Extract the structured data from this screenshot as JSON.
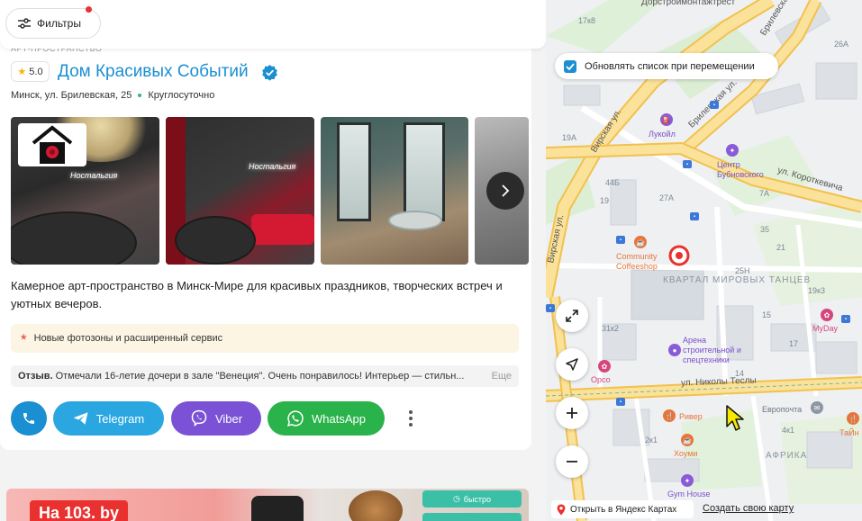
{
  "filters": {
    "label": "Фильтры"
  },
  "card": {
    "category": "АРТ-ПРОСТРАНСТВО",
    "rating": "5.0",
    "title": "Дом Красивых Событий",
    "address": "Минск, ул. Брилевская, 25",
    "hours": "Круглосуточно",
    "description": "Камерное арт-пространство в Минск-Мире для красивых праздников, творческих встреч и уютных вечеров.",
    "promo": "Новые фотозоны и расширенный сервис",
    "review_label": "Отзыв.",
    "review_text": "Отмечали 16-летие дочери в зале \"Венеция\". Очень понравилось! Интерьер — стильн...",
    "review_more": "Еще",
    "buttons": {
      "telegram": "Telegram",
      "viber": "Viber",
      "whatsapp": "WhatsApp"
    }
  },
  "banner": {
    "tag": "На 103. by",
    "pill1": "быстро"
  },
  "map": {
    "update_checkbox_label": "Обновлять список при перемещении",
    "update_checked": true,
    "open_yandex": "Открыть в Яндекс Картах",
    "create_map": "Создать свою карту",
    "streets": {
      "virskaya_top": "Вирская ул.",
      "virskaya_mid": "Вирская ул.",
      "brilevskaya_top": "Брилевская",
      "brilevskaya_mid": "Брилевская ул.",
      "korotkevicha": "ул. Короткевича",
      "tesly": "ул. Николы Теслы",
      "dorstroy": "Дорстроймонтажтрест"
    },
    "houses": [
      "17к8",
      "26А",
      "19А",
      "44Б",
      "27А",
      "7А",
      "25Н",
      "21",
      "19к3",
      "15",
      "31к2",
      "17",
      "2к1",
      "4к1",
      "14",
      "19",
      "35"
    ],
    "pois": {
      "lukoil": "Лукойл",
      "bubnovsky": "Центр Бубновского",
      "community": "Community Coffeeshop",
      "kvartal": "КВАРТАЛ МИРОВЫХ ТАНЦЕВ",
      "arena": "Арена строительной и спецтехники",
      "myday": "MyDay",
      "orso": "Орсо",
      "river": "Ривер",
      "evropochta": "Европочта",
      "houmi": "Хоуми",
      "afrika": "АФРИКА",
      "gymhouse": "Gym House",
      "taina": "ТаЙн"
    }
  },
  "colors": {
    "accent": "#1a8fd1",
    "telegram": "#2aa7e0",
    "viber": "#7b52d6",
    "whatsapp": "#29b34a",
    "map_road": "#f7d27a",
    "map_marker": "#e9312f"
  }
}
